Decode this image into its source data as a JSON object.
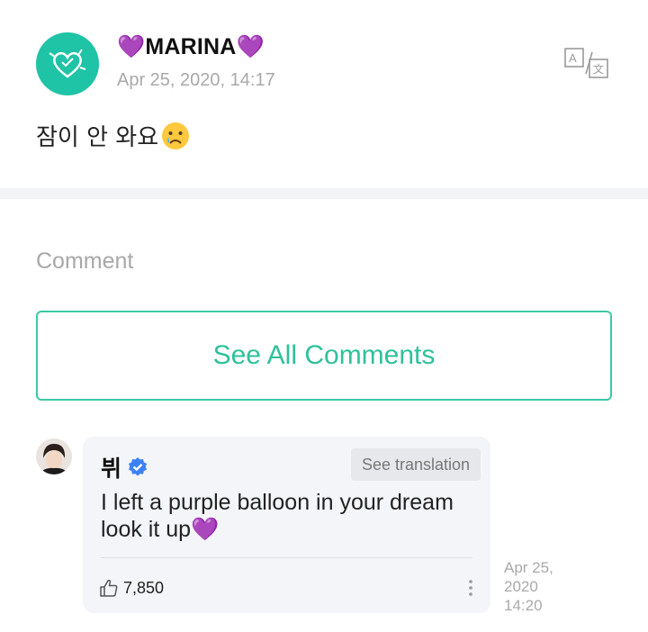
{
  "post": {
    "author": "💜MARINA💜",
    "date": "Apr 25, 2020, 14:17",
    "body": "잠이 안 와요",
    "emoji_icon": "sad-face-icon"
  },
  "comments_section": {
    "heading": "Comment",
    "see_all_label": "See All Comments"
  },
  "comment": {
    "author": "뷔",
    "verified_icon": "verified-badge-icon",
    "see_translation_label": "See translation",
    "text": "I left a purple balloon in your dream look it up💜",
    "likes": "7,850",
    "date": "Apr 25,\n2020\n14:20"
  },
  "colors": {
    "accent": "#2fc19b",
    "avatar_bg": "#1fc3a6",
    "verified": "#3b82f6"
  }
}
